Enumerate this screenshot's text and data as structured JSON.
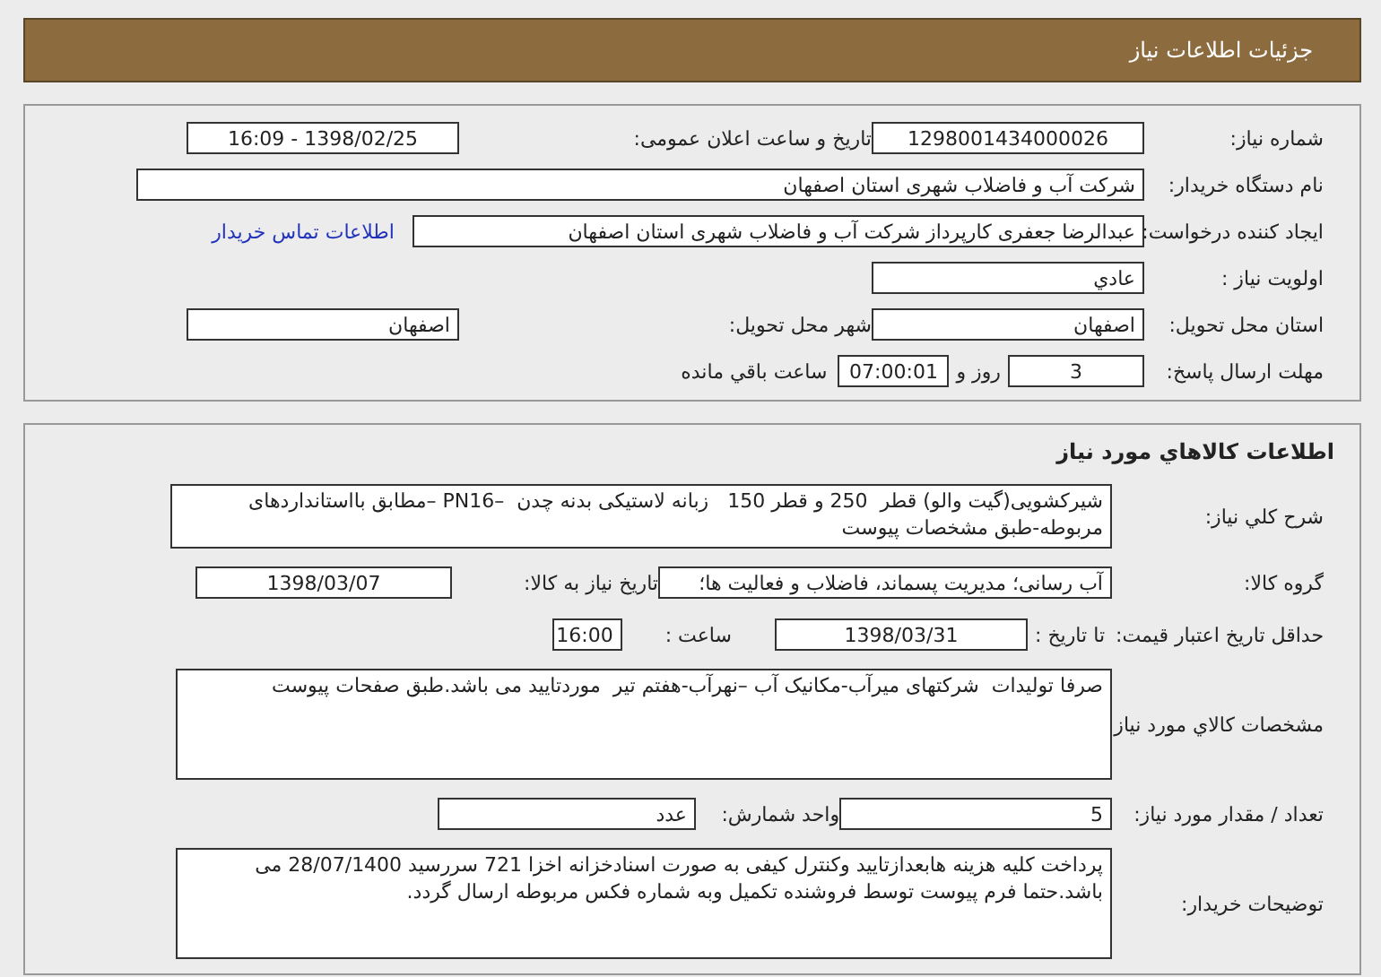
{
  "header": {
    "title": "جزئیات اطلاعات نیاز"
  },
  "need_info": {
    "need_number": {
      "label": "شماره نیاز:",
      "value": "1298001434000026"
    },
    "announce_date": {
      "label": "تاریخ و ساعت اعلان عمومی:",
      "value": "1398/02/25 - 16:09"
    },
    "buyer_org": {
      "label": "نام دستگاه خریدار:",
      "value": "شرکت آب و فاضلاب شهری استان اصفهان"
    },
    "requester": {
      "label": "ایجاد کننده درخواست:",
      "value": "عبدالرضا جعفری کارپرداز شرکت آب و فاضلاب شهری استان اصفهان",
      "link": "اطلاعات تماس خریدار"
    },
    "priority": {
      "label": "اولویت نیاز :",
      "value": "عادي"
    },
    "province": {
      "label": "استان محل تحویل:",
      "value": "اصفهان"
    },
    "city": {
      "label": "شهر محل تحویل:",
      "value": "اصفهان"
    },
    "deadline": {
      "label": "مهلت ارسال پاسخ:",
      "days": "3",
      "days_suffix": "روز و",
      "time": "07:00:01",
      "time_suffix": "ساعت باقي مانده"
    }
  },
  "goods": {
    "title": "اطلاعات کالاهاي مورد نياز",
    "description": {
      "label": "شرح کلي نياز:",
      "value": "شیرکشویی(گیت والو) قطر  250 و قطر 150   زبانه لاستیکی بدنه چدن  –PN16 –مطابق بااستانداردهای مربوطه-طبق مشخصات پیوست"
    },
    "group": {
      "label": "گروه کالا:",
      "value": "آب رسانی؛ مدیریت پسماند، فاضلاب و فعالیت ها؛"
    },
    "need_date": {
      "label": "تاريخ نياز به کالا:",
      "value": "1398/03/07"
    },
    "validity": {
      "label": "حداقل تاريخ اعتبار قيمت:",
      "to_label": "تا تاريخ :",
      "date": "1398/03/31",
      "time_label": "ساعت :",
      "time": "16:00"
    },
    "specs": {
      "label": "مشخصات کالاي مورد نياز:",
      "value": "صرفا تولیدات  شرکتهای میرآب-مکانیک آب –نهرآب-هفتم تیر  موردتایید می باشد.طبق صفحات پیوست"
    },
    "quantity": {
      "label": "تعداد / مقدار مورد نياز:",
      "value": "5"
    },
    "unit": {
      "label": "واحد شمارش:",
      "value": "عدد"
    },
    "notes": {
      "label": "توضيحات خريدار:",
      "value": "پرداخت کلیه هزینه هابعدازتایید وکنترل کیفی به صورت اسنادخزانه اخزا 721 سررسید 28/07/1400 می باشد.حتما فرم پیوست توسط فروشنده تکمیل وبه شماره فکس مربوطه ارسال گردد."
    }
  }
}
